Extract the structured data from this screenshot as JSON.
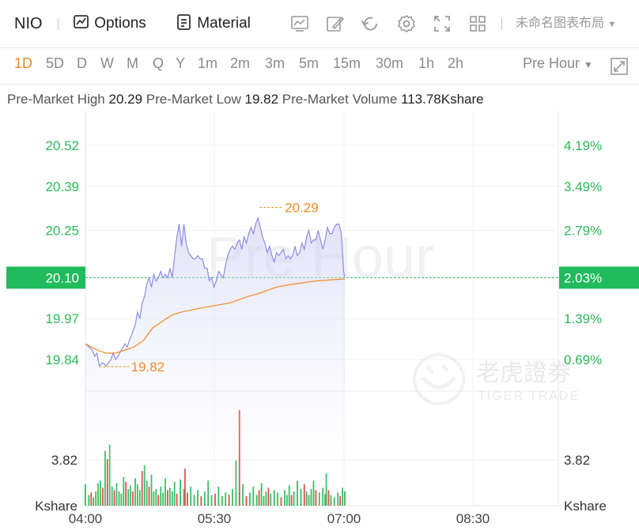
{
  "toolbar": {
    "symbol": "NIO",
    "options_label": "Options",
    "material_label": "Material",
    "layout_name": "未命名图表布局",
    "icons": [
      "chart-style-icon",
      "draw-icon",
      "reset-icon",
      "settings-icon",
      "fullscreen-icon",
      "grid-layout-icon"
    ]
  },
  "periods": {
    "items": [
      "1D",
      "5D",
      "D",
      "W",
      "M",
      "Q",
      "Y",
      "1m",
      "2m",
      "3m",
      "5m",
      "15m",
      "30m",
      "1h",
      "2h"
    ],
    "active": "1D",
    "session": "Pre Hour"
  },
  "stats": {
    "high_label": "Pre-Market High",
    "high_value": "20.29",
    "low_label": "Pre-Market Low",
    "low_value": "19.82",
    "volume_label": "Pre-Market Volume",
    "volume_value": "113.78Kshare"
  },
  "watermark": {
    "session_text": "Pre Hour",
    "brand_cn": "老虎證劵",
    "brand_en": "TIGER TRADE"
  },
  "colors": {
    "up": "#2db85a",
    "down": "#e8403f",
    "price_line": "#8c8ce6",
    "avg_line": "#f08a24",
    "current": "#1fbb5c"
  },
  "chart_data": {
    "type": "line",
    "x_ticks": [
      "04:00",
      "05:30",
      "07:00",
      "08:30"
    ],
    "y_ticks_left": [
      "20.52",
      "20.39",
      "20.25",
      "20.10",
      "19.97",
      "19.84"
    ],
    "y_ticks_right": [
      "4.19%",
      "3.49%",
      "2.79%",
      "2.03%",
      "1.39%",
      "0.69%"
    ],
    "ylim": [
      19.78,
      20.58
    ],
    "current_price": "20.10",
    "current_pct": "2.03%",
    "high_annotation": "20.29",
    "low_annotation": "19.82",
    "price_series": [
      [
        0,
        19.89
      ],
      [
        3,
        19.88
      ],
      [
        6,
        19.87
      ],
      [
        8,
        19.85
      ],
      [
        10,
        19.86
      ],
      [
        12,
        19.82
      ],
      [
        15,
        19.83
      ],
      [
        18,
        19.82
      ],
      [
        22,
        19.84
      ],
      [
        24,
        19.86
      ],
      [
        26,
        19.84
      ],
      [
        28,
        19.85
      ],
      [
        31,
        19.87
      ],
      [
        34,
        19.89
      ],
      [
        36,
        19.88
      ],
      [
        38,
        19.9
      ],
      [
        40,
        19.92
      ],
      [
        43,
        19.95
      ],
      [
        45,
        19.99
      ],
      [
        47,
        19.97
      ],
      [
        49,
        20.02
      ],
      [
        51,
        20.04
      ],
      [
        53,
        20.08
      ],
      [
        55,
        20.1
      ],
      [
        57,
        20.07
      ],
      [
        59,
        20.11
      ],
      [
        61,
        20.09
      ],
      [
        63,
        20.1
      ],
      [
        65,
        20.12
      ],
      [
        67,
        20.1
      ],
      [
        69,
        20.11
      ],
      [
        71,
        20.1
      ],
      [
        73,
        20.13
      ],
      [
        75,
        20.1
      ],
      [
        77,
        20.17
      ],
      [
        79,
        20.23
      ],
      [
        81,
        20.27
      ],
      [
        83,
        20.2
      ],
      [
        85,
        20.27
      ],
      [
        87,
        20.21
      ],
      [
        89,
        20.18
      ],
      [
        91,
        20.17
      ],
      [
        93,
        20.16
      ],
      [
        95,
        20.16
      ],
      [
        97,
        20.17
      ],
      [
        99,
        20.16
      ],
      [
        101,
        20.16
      ],
      [
        103,
        20.13
      ],
      [
        105,
        20.13
      ],
      [
        107,
        20.09
      ],
      [
        109,
        20.1
      ],
      [
        111,
        20.07
      ],
      [
        113,
        20.09
      ],
      [
        115,
        20.12
      ],
      [
        117,
        20.11
      ],
      [
        119,
        20.1
      ],
      [
        121,
        20.14
      ],
      [
        123,
        20.17
      ],
      [
        125,
        20.19
      ],
      [
        127,
        20.2
      ],
      [
        129,
        20.19
      ],
      [
        131,
        20.21
      ],
      [
        133,
        20.22
      ],
      [
        135,
        20.19
      ],
      [
        137,
        20.23
      ],
      [
        139,
        20.21
      ],
      [
        141,
        20.24
      ],
      [
        143,
        20.26
      ],
      [
        145,
        20.24
      ],
      [
        147,
        20.27
      ],
      [
        149,
        20.29
      ],
      [
        151,
        20.26
      ],
      [
        153,
        20.23
      ],
      [
        155,
        20.21
      ],
      [
        157,
        20.18
      ],
      [
        159,
        20.2
      ],
      [
        161,
        20.17
      ],
      [
        163,
        20.15
      ],
      [
        165,
        20.18
      ],
      [
        167,
        20.17
      ],
      [
        169,
        20.18
      ],
      [
        171,
        20.19
      ],
      [
        173,
        20.16
      ],
      [
        175,
        20.17
      ],
      [
        177,
        20.16
      ],
      [
        179,
        20.17
      ],
      [
        181,
        20.2
      ],
      [
        183,
        20.17
      ],
      [
        185,
        20.18
      ],
      [
        187,
        20.21
      ],
      [
        189,
        20.19
      ],
      [
        191,
        20.23
      ],
      [
        193,
        20.25
      ],
      [
        195,
        20.21
      ],
      [
        197,
        20.22
      ],
      [
        199,
        20.22
      ],
      [
        201,
        20.25
      ],
      [
        203,
        20.22
      ],
      [
        205,
        20.19
      ],
      [
        207,
        20.22
      ],
      [
        209,
        20.26
      ],
      [
        211,
        20.24
      ],
      [
        213,
        20.24
      ],
      [
        215,
        20.26
      ],
      [
        217,
        20.27
      ],
      [
        219,
        20.27
      ],
      [
        221,
        20.24
      ],
      [
        223,
        20.12
      ],
      [
        224,
        20.1
      ]
    ],
    "avg_series": [
      [
        0,
        19.89
      ],
      [
        10,
        19.87
      ],
      [
        18,
        19.86
      ],
      [
        26,
        19.86
      ],
      [
        34,
        19.87
      ],
      [
        42,
        19.88
      ],
      [
        50,
        19.9
      ],
      [
        58,
        19.94
      ],
      [
        66,
        19.96
      ],
      [
        74,
        19.98
      ],
      [
        82,
        19.99
      ],
      [
        95,
        20.0
      ],
      [
        110,
        20.01
      ],
      [
        125,
        20.02
      ],
      [
        140,
        20.04
      ],
      [
        150,
        20.05
      ],
      [
        165,
        20.07
      ],
      [
        180,
        20.08
      ],
      [
        200,
        20.09
      ],
      [
        224,
        20.096
      ]
    ],
    "volume": {
      "unit": "Kshare",
      "scale_tick": "3.82",
      "ymax": 8.2,
      "bars": [
        [
          0,
          1.8,
          "g"
        ],
        [
          3,
          0.9,
          "g"
        ],
        [
          5,
          1.1,
          "r"
        ],
        [
          7,
          0.7,
          "g"
        ],
        [
          9,
          1.2,
          "g"
        ],
        [
          11,
          1.9,
          "g"
        ],
        [
          13,
          2.1,
          "g"
        ],
        [
          15,
          1.5,
          "r"
        ],
        [
          17,
          4.6,
          "g"
        ],
        [
          19,
          3.9,
          "r"
        ],
        [
          21,
          5.1,
          "g"
        ],
        [
          23,
          1.6,
          "g"
        ],
        [
          25,
          1.3,
          "r"
        ],
        [
          27,
          1.9,
          "g"
        ],
        [
          29,
          1.2,
          "g"
        ],
        [
          31,
          1.0,
          "g"
        ],
        [
          33,
          2.4,
          "g"
        ],
        [
          35,
          2.0,
          "r"
        ],
        [
          37,
          1.4,
          "g"
        ],
        [
          39,
          1.7,
          "g"
        ],
        [
          41,
          1.2,
          "r"
        ],
        [
          43,
          2.3,
          "g"
        ],
        [
          45,
          1.8,
          "g"
        ],
        [
          47,
          1.3,
          "g"
        ],
        [
          49,
          2.9,
          "r"
        ],
        [
          51,
          3.4,
          "g"
        ],
        [
          53,
          2.1,
          "g"
        ],
        [
          55,
          1.6,
          "r"
        ],
        [
          57,
          2.6,
          "g"
        ],
        [
          59,
          1.2,
          "g"
        ],
        [
          61,
          1.4,
          "g"
        ],
        [
          63,
          0.9,
          "r"
        ],
        [
          65,
          1.6,
          "g"
        ],
        [
          67,
          1.1,
          "g"
        ],
        [
          69,
          2.3,
          "g"
        ],
        [
          71,
          1.3,
          "r"
        ],
        [
          73,
          1.5,
          "g"
        ],
        [
          75,
          1.2,
          "g"
        ],
        [
          77,
          2.0,
          "g"
        ],
        [
          79,
          1.0,
          "r"
        ],
        [
          82,
          2.2,
          "g"
        ],
        [
          85,
          1.4,
          "g"
        ],
        [
          88,
          1.1,
          "r"
        ],
        [
          91,
          1.6,
          "g"
        ],
        [
          94,
          0.9,
          "g"
        ],
        [
          97,
          1.3,
          "g"
        ],
        [
          100,
          0.8,
          "r"
        ],
        [
          103,
          1.2,
          "g"
        ],
        [
          106,
          2.1,
          "g"
        ],
        [
          109,
          0.9,
          "g"
        ],
        [
          112,
          1.0,
          "r"
        ],
        [
          115,
          1.6,
          "g"
        ],
        [
          118,
          0.8,
          "g"
        ],
        [
          121,
          1.1,
          "g"
        ],
        [
          124,
          0.9,
          "r"
        ],
        [
          127,
          1.4,
          "g"
        ],
        [
          130,
          0.7,
          "g"
        ],
        [
          133,
          1.2,
          "g"
        ],
        [
          136,
          1.8,
          "g"
        ],
        [
          139,
          0.8,
          "r"
        ],
        [
          142,
          1.1,
          "g"
        ],
        [
          145,
          1.6,
          "g"
        ],
        [
          148,
          0.9,
          "g"
        ],
        [
          150,
          1.3,
          "r"
        ],
        [
          152,
          1.9,
          "g"
        ],
        [
          154,
          0.8,
          "g"
        ],
        [
          156,
          1.2,
          "g"
        ],
        [
          158,
          1.5,
          "r"
        ],
        [
          160,
          1.0,
          "g"
        ],
        [
          163,
          1.3,
          "g"
        ],
        [
          166,
          1.1,
          "g"
        ],
        [
          169,
          0.7,
          "r"
        ],
        [
          172,
          1.3,
          "g"
        ],
        [
          174,
          0.9,
          "g"
        ],
        [
          176,
          1.7,
          "g"
        ],
        [
          178,
          0.9,
          "r"
        ],
        [
          180,
          1.2,
          "g"
        ],
        [
          183,
          2.1,
          "g"
        ],
        [
          186,
          1.4,
          "g"
        ],
        [
          189,
          1.8,
          "r"
        ],
        [
          191,
          1.2,
          "g"
        ],
        [
          193,
          0.9,
          "g"
        ],
        [
          195,
          1.4,
          "g"
        ],
        [
          197,
          2.1,
          "g"
        ],
        [
          199,
          1.3,
          "r"
        ],
        [
          202,
          1.1,
          "g"
        ],
        [
          205,
          1.5,
          "g"
        ],
        [
          207,
          1.0,
          "g"
        ],
        [
          210,
          1.3,
          "r"
        ],
        [
          212,
          0.9,
          "g"
        ],
        [
          215,
          0.7,
          "g"
        ],
        [
          218,
          1.1,
          "g"
        ],
        [
          220,
          0.8,
          "r"
        ],
        [
          222,
          1.5,
          "g"
        ],
        [
          224,
          1.2,
          "g"
        ],
        [
          133,
          8.0,
          "r"
        ],
        [
          86,
          3.1,
          "r"
        ],
        [
          130,
          3.8,
          "g"
        ],
        [
          208,
          2.7,
          "g"
        ]
      ]
    }
  }
}
